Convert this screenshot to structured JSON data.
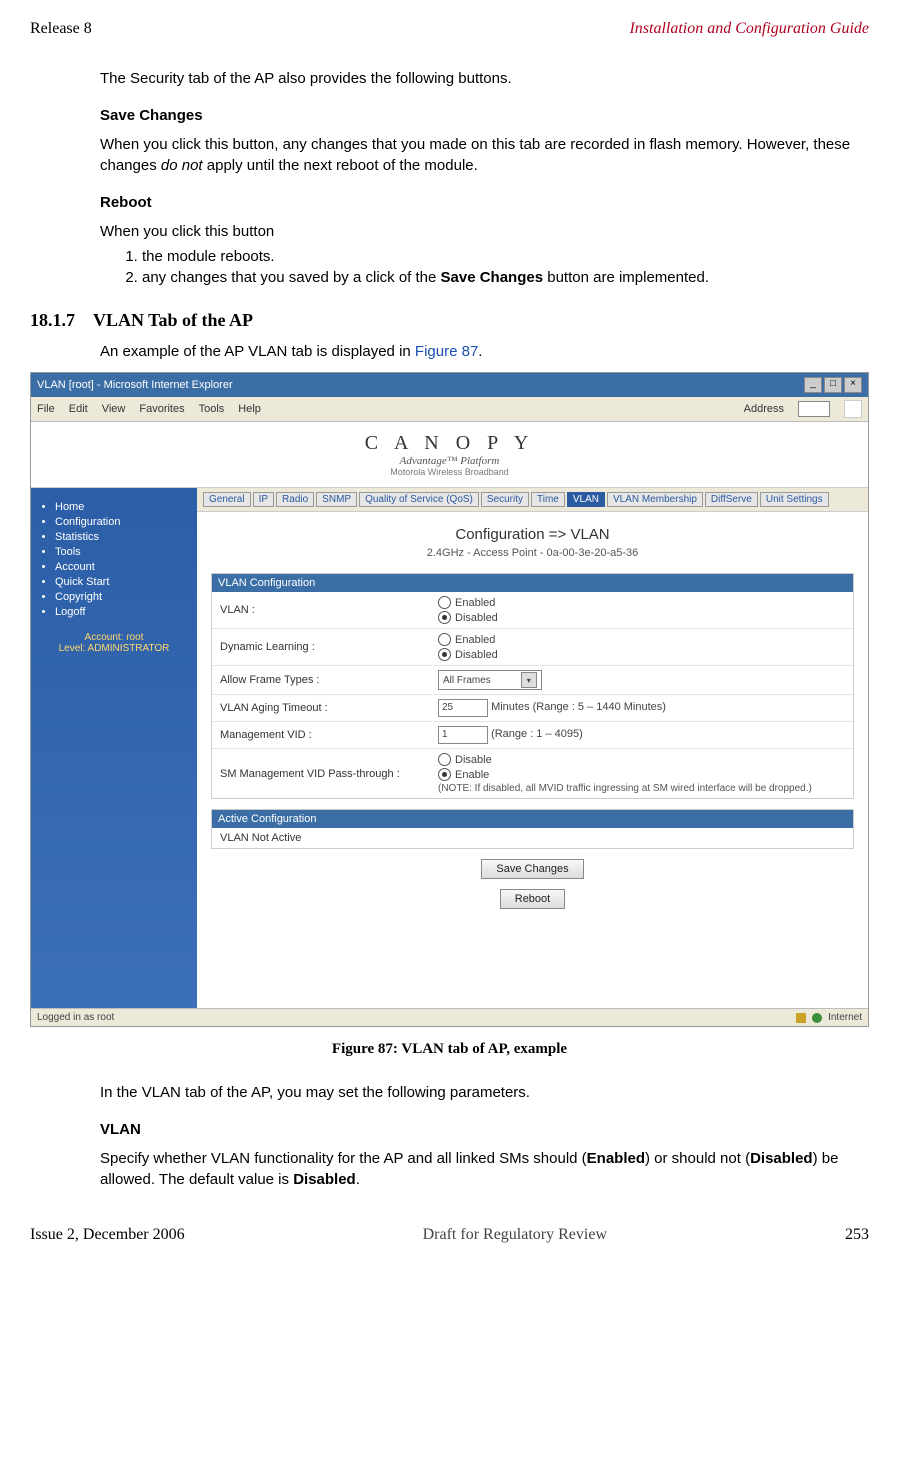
{
  "header": {
    "left": "Release 8",
    "right": "Installation and Configuration Guide"
  },
  "intro": "The Security tab of the AP also provides the following buttons.",
  "save_changes": {
    "title": "Save Changes",
    "text_before": "When you click this button, any changes that you made on this tab are recorded in flash memory. However, these changes ",
    "emph": "do not",
    "text_after": " apply until the next reboot of the module."
  },
  "reboot": {
    "title": "Reboot",
    "lead": "When you click this button",
    "items": [
      "the module reboots.",
      {
        "pre": "any changes that you saved by a click of the ",
        "bold": "Save Changes",
        "post": " button are implemented."
      }
    ]
  },
  "section": {
    "num": "18.1.7",
    "title": "VLAN Tab of the AP"
  },
  "section_lead": {
    "pre": "An example of the AP VLAN tab is displayed in ",
    "link": "Figure 87",
    "post": "."
  },
  "figure_caption": "Figure 87: VLAN tab of AP, example",
  "post_fig": "In the VLAN tab of the AP, you may set the following parameters.",
  "vlan_param": {
    "title": "VLAN",
    "pre": "Specify whether VLAN functionality for the AP and all linked SMs should (",
    "b1": "Enabled",
    "mid": ") or should not (",
    "b2": "Disabled",
    "post": ") be allowed. The default value is ",
    "b3": "Disabled",
    "end": "."
  },
  "footer": {
    "left": "Issue 2, December 2006",
    "mid": "Draft for Regulatory Review",
    "right": "253"
  },
  "screenshot": {
    "title": "VLAN [root] - Microsoft Internet Explorer",
    "menus": [
      "File",
      "Edit",
      "View",
      "Favorites",
      "Tools",
      "Help"
    ],
    "address_label": "Address",
    "logo_main": "C A N O P Y",
    "logo_tag": "Advantage™ Platform",
    "logo_sub": "Motorola Wireless Broadband",
    "sidebar_items": [
      "Home",
      "Configuration",
      "Statistics",
      "Tools",
      "Account",
      "Quick Start",
      "Copyright",
      "Logoff"
    ],
    "account_line1": "Account: root",
    "account_line2": "Level: ADMINISTRATOR",
    "tabs": [
      "General",
      "IP",
      "Radio",
      "SNMP",
      "Quality of Service (QoS)",
      "Security",
      "Time",
      "VLAN",
      "VLAN Membership",
      "DiffServe",
      "Unit Settings"
    ],
    "active_tab_index": 7,
    "config_title": "Configuration => VLAN",
    "subtitle": "2.4GHz - Access Point - 0a-00-3e-20-a5-36",
    "panel1_title": "VLAN Configuration",
    "rows": {
      "vlan_label": "VLAN :",
      "vlan_opts": [
        "Enabled",
        "Disabled"
      ],
      "vlan_selected": 1,
      "dyn_label": "Dynamic Learning :",
      "dyn_opts": [
        "Enabled",
        "Disabled"
      ],
      "dyn_selected": 1,
      "allow_label": "Allow Frame Types :",
      "allow_value": "All Frames",
      "aging_label": "VLAN Aging Timeout :",
      "aging_value": "25",
      "aging_hint": "Minutes (Range : 5 – 1440 Minutes)",
      "mvid_label": "Management VID :",
      "mvid_value": "1",
      "mvid_hint": "(Range : 1 – 4095)",
      "smpt_label": "SM Management VID Pass-through :",
      "smpt_opts": [
        "Disable",
        "Enable"
      ],
      "smpt_selected": 1,
      "smpt_note": "(NOTE: If disabled, all MVID traffic ingressing at SM wired interface will be dropped.)"
    },
    "panel2_title": "Active Configuration",
    "panel2_text": "VLAN Not Active",
    "btn_save": "Save Changes",
    "btn_reboot": "Reboot",
    "status_left": "Logged in as root",
    "status_right": "Internet"
  }
}
